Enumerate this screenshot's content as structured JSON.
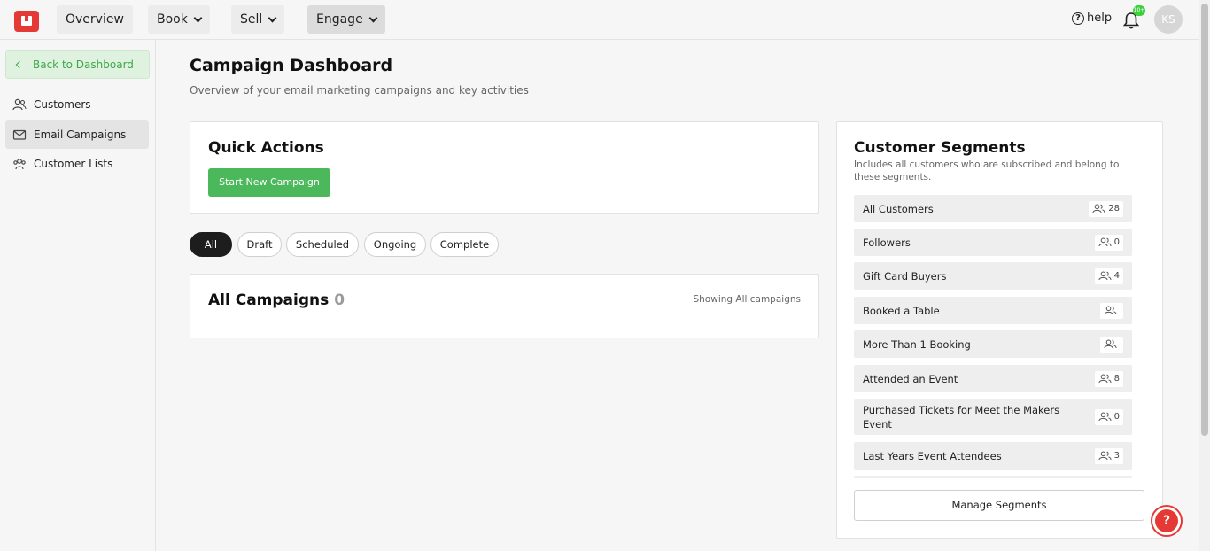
{
  "topbar": {
    "nav": [
      "Overview",
      "Book",
      "Sell",
      "Engage"
    ],
    "help": "help",
    "notif_badge": "10+",
    "avatar": "KS"
  },
  "sidebar": {
    "back": "Back to Dashboard",
    "items": [
      {
        "label": "Customers",
        "icon": "customers-icon"
      },
      {
        "label": "Email Campaigns",
        "icon": "mail-icon",
        "active": true
      },
      {
        "label": "Customer Lists",
        "icon": "customer-lists-icon"
      }
    ]
  },
  "page": {
    "title": "Campaign Dashboard",
    "subtitle": "Overview of your email marketing campaigns and key activities"
  },
  "quick_actions": {
    "title": "Quick Actions",
    "button": "Start New Campaign"
  },
  "filters": [
    "All",
    "Draft",
    "Scheduled",
    "Ongoing",
    "Complete"
  ],
  "campaigns": {
    "title": "All Campaigns",
    "count": "0",
    "showing": "Showing All campaigns"
  },
  "segments": {
    "title": "Customer Segments",
    "description": "Includes all customers who are subscribed and belong to these segments.",
    "items": [
      {
        "name": "All Customers",
        "count": "28"
      },
      {
        "name": "Followers",
        "count": "0"
      },
      {
        "name": "Gift Card Buyers",
        "count": "4"
      },
      {
        "name": "Booked a Table",
        "count": ""
      },
      {
        "name": "More Than 1 Booking",
        "count": ""
      },
      {
        "name": "Attended an Event",
        "count": "8"
      },
      {
        "name": "Purchased Tickets for Meet the Makers Event",
        "count": "0"
      },
      {
        "name": "Last Years Event Attendees",
        "count": "3"
      }
    ],
    "manage": "Manage Segments"
  },
  "help_fab": "?",
  "colors": {
    "brand": "#e53935",
    "accent": "#4cb85c",
    "active_pill": "#1d1d1d"
  }
}
